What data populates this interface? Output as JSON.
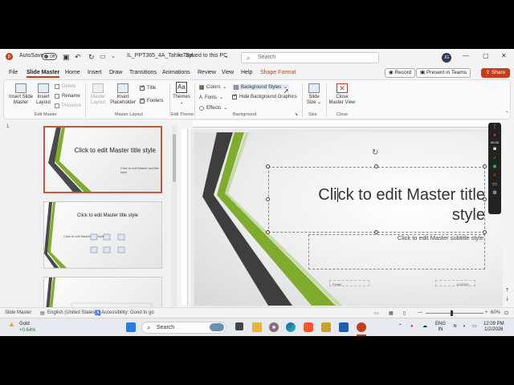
{
  "titlebar": {
    "autosave_label": "AutoSave",
    "autosave_state": "Off",
    "file_name": "IL_PPT365_4A_TahliaTayl...",
    "save_status": "Saved to this PC",
    "search_placeholder": "Search",
    "user_initials": "JG"
  },
  "menu": {
    "tabs": [
      "File",
      "Slide Master",
      "Home",
      "Insert",
      "Draw",
      "Transitions",
      "Animations",
      "Review",
      "View",
      "Help",
      "Shape Format"
    ],
    "active_tab": "Slide Master",
    "record_label": "Record",
    "present_label": "Present in Teams",
    "share_label": "Share"
  },
  "ribbon": {
    "edit_master": {
      "insert_slide_master": "Insert Slide Master",
      "insert_layout": "Insert Layout",
      "delete": "Delete",
      "rename": "Rename",
      "preserve": "Preserve",
      "group_label": "Edit Master"
    },
    "master_layout": {
      "master_layout": "Master Layout",
      "insert_placeholder": "Insert Placeholder",
      "title": "Title",
      "footers": "Footers",
      "group_label": "Master Layout"
    },
    "edit_theme": {
      "themes": "Themes",
      "group_label": "Edit Theme"
    },
    "background": {
      "colors": "Colors",
      "fonts": "Fonts",
      "effects": "Effects",
      "background_styles": "Background Styles",
      "hide_background_graphics": "Hide Background Graphics",
      "group_label": "Background"
    },
    "size": {
      "slide_size": "Slide Size",
      "group_label": "Size"
    },
    "close": {
      "close_master_view": "Close Master View",
      "group_label": "Close"
    }
  },
  "thumbnails": [
    {
      "number": "1",
      "title": "Click to edit Master title style",
      "subtitle": "Click to edit Master subtitle style"
    },
    {
      "number": "",
      "title": "Click to edit Master title style",
      "body": "Click to edit Master text styles"
    },
    {
      "number": "",
      "title": ""
    }
  ],
  "slide": {
    "title": "Click to edit Master title style",
    "subtitle": "Click to edit Master subtitle style",
    "footer": "Footer",
    "date": "1/2/2026"
  },
  "recorder": {
    "time": "00:00"
  },
  "status": {
    "view": "Slide Master",
    "language": "English (United States)",
    "accessibility": "Accessibility: Good to go",
    "zoom": "60%"
  },
  "taskbar": {
    "weather_name": "Gold",
    "weather_change": "+0.64%",
    "search_label": "Search",
    "lang_top": "ENG",
    "lang_bottom": "IN",
    "time": "12:09 PM",
    "date": "1/2/2026"
  },
  "colors": {
    "accent": "#c43e1c",
    "green_stripe": "#7fac2d",
    "dark_stripe": "#444444"
  }
}
